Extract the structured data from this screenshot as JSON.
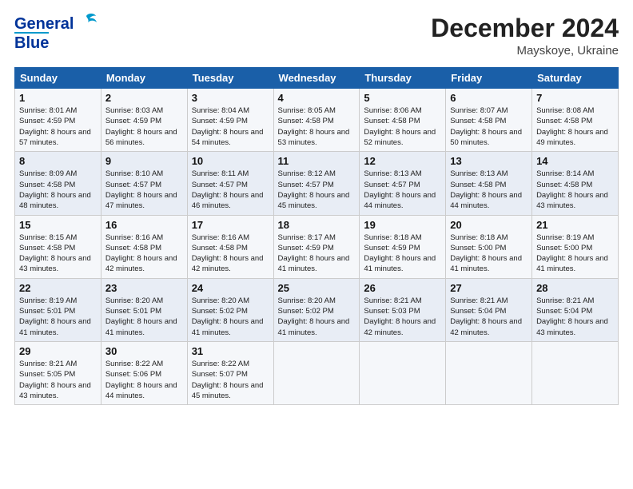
{
  "header": {
    "logo_line1": "General",
    "logo_line2": "Blue",
    "month": "December 2024",
    "location": "Mayskoye, Ukraine"
  },
  "days_of_week": [
    "Sunday",
    "Monday",
    "Tuesday",
    "Wednesday",
    "Thursday",
    "Friday",
    "Saturday"
  ],
  "weeks": [
    [
      {
        "day": "1",
        "sunrise": "8:01 AM",
        "sunset": "4:59 PM",
        "daylight": "8 hours and 57 minutes."
      },
      {
        "day": "2",
        "sunrise": "8:03 AM",
        "sunset": "4:59 PM",
        "daylight": "8 hours and 56 minutes."
      },
      {
        "day": "3",
        "sunrise": "8:04 AM",
        "sunset": "4:59 PM",
        "daylight": "8 hours and 54 minutes."
      },
      {
        "day": "4",
        "sunrise": "8:05 AM",
        "sunset": "4:58 PM",
        "daylight": "8 hours and 53 minutes."
      },
      {
        "day": "5",
        "sunrise": "8:06 AM",
        "sunset": "4:58 PM",
        "daylight": "8 hours and 52 minutes."
      },
      {
        "day": "6",
        "sunrise": "8:07 AM",
        "sunset": "4:58 PM",
        "daylight": "8 hours and 50 minutes."
      },
      {
        "day": "7",
        "sunrise": "8:08 AM",
        "sunset": "4:58 PM",
        "daylight": "8 hours and 49 minutes."
      }
    ],
    [
      {
        "day": "8",
        "sunrise": "8:09 AM",
        "sunset": "4:58 PM",
        "daylight": "8 hours and 48 minutes."
      },
      {
        "day": "9",
        "sunrise": "8:10 AM",
        "sunset": "4:57 PM",
        "daylight": "8 hours and 47 minutes."
      },
      {
        "day": "10",
        "sunrise": "8:11 AM",
        "sunset": "4:57 PM",
        "daylight": "8 hours and 46 minutes."
      },
      {
        "day": "11",
        "sunrise": "8:12 AM",
        "sunset": "4:57 PM",
        "daylight": "8 hours and 45 minutes."
      },
      {
        "day": "12",
        "sunrise": "8:13 AM",
        "sunset": "4:57 PM",
        "daylight": "8 hours and 44 minutes."
      },
      {
        "day": "13",
        "sunrise": "8:13 AM",
        "sunset": "4:58 PM",
        "daylight": "8 hours and 44 minutes."
      },
      {
        "day": "14",
        "sunrise": "8:14 AM",
        "sunset": "4:58 PM",
        "daylight": "8 hours and 43 minutes."
      }
    ],
    [
      {
        "day": "15",
        "sunrise": "8:15 AM",
        "sunset": "4:58 PM",
        "daylight": "8 hours and 43 minutes."
      },
      {
        "day": "16",
        "sunrise": "8:16 AM",
        "sunset": "4:58 PM",
        "daylight": "8 hours and 42 minutes."
      },
      {
        "day": "17",
        "sunrise": "8:16 AM",
        "sunset": "4:58 PM",
        "daylight": "8 hours and 42 minutes."
      },
      {
        "day": "18",
        "sunrise": "8:17 AM",
        "sunset": "4:59 PM",
        "daylight": "8 hours and 41 minutes."
      },
      {
        "day": "19",
        "sunrise": "8:18 AM",
        "sunset": "4:59 PM",
        "daylight": "8 hours and 41 minutes."
      },
      {
        "day": "20",
        "sunrise": "8:18 AM",
        "sunset": "5:00 PM",
        "daylight": "8 hours and 41 minutes."
      },
      {
        "day": "21",
        "sunrise": "8:19 AM",
        "sunset": "5:00 PM",
        "daylight": "8 hours and 41 minutes."
      }
    ],
    [
      {
        "day": "22",
        "sunrise": "8:19 AM",
        "sunset": "5:01 PM",
        "daylight": "8 hours and 41 minutes."
      },
      {
        "day": "23",
        "sunrise": "8:20 AM",
        "sunset": "5:01 PM",
        "daylight": "8 hours and 41 minutes."
      },
      {
        "day": "24",
        "sunrise": "8:20 AM",
        "sunset": "5:02 PM",
        "daylight": "8 hours and 41 minutes."
      },
      {
        "day": "25",
        "sunrise": "8:20 AM",
        "sunset": "5:02 PM",
        "daylight": "8 hours and 41 minutes."
      },
      {
        "day": "26",
        "sunrise": "8:21 AM",
        "sunset": "5:03 PM",
        "daylight": "8 hours and 42 minutes."
      },
      {
        "day": "27",
        "sunrise": "8:21 AM",
        "sunset": "5:04 PM",
        "daylight": "8 hours and 42 minutes."
      },
      {
        "day": "28",
        "sunrise": "8:21 AM",
        "sunset": "5:04 PM",
        "daylight": "8 hours and 43 minutes."
      }
    ],
    [
      {
        "day": "29",
        "sunrise": "8:21 AM",
        "sunset": "5:05 PM",
        "daylight": "8 hours and 43 minutes."
      },
      {
        "day": "30",
        "sunrise": "8:22 AM",
        "sunset": "5:06 PM",
        "daylight": "8 hours and 44 minutes."
      },
      {
        "day": "31",
        "sunrise": "8:22 AM",
        "sunset": "5:07 PM",
        "daylight": "8 hours and 45 minutes."
      },
      null,
      null,
      null,
      null
    ]
  ]
}
